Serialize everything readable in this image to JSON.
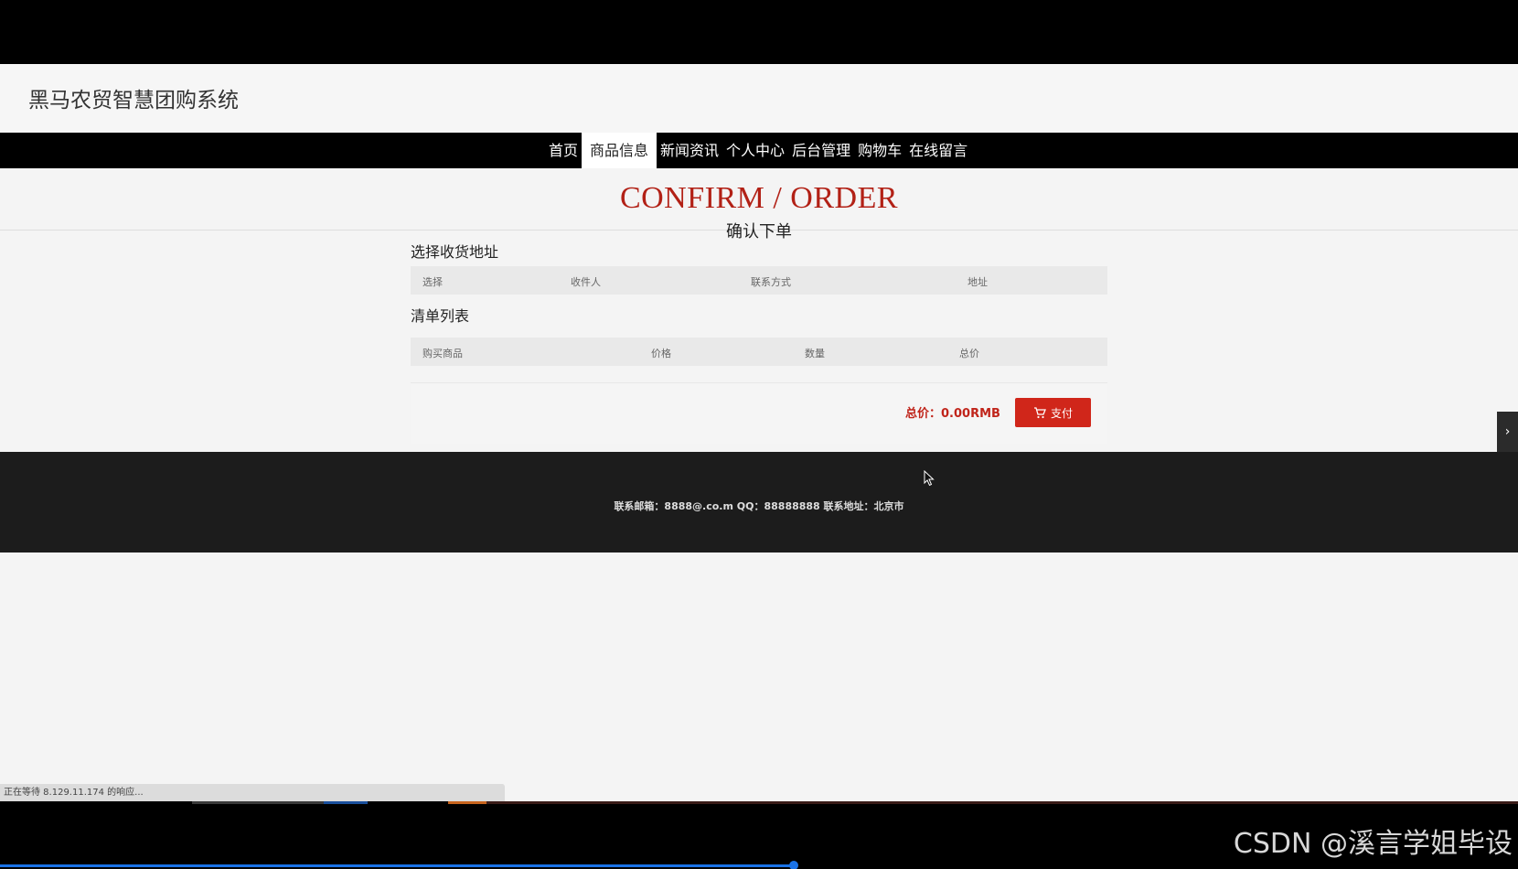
{
  "site": {
    "title": "黑马农贸智慧团购系统"
  },
  "nav": {
    "items": [
      {
        "label": "首页",
        "active": false
      },
      {
        "label": "商品信息",
        "active": true
      },
      {
        "label": "新闻资讯",
        "active": false
      },
      {
        "label": "个人中心",
        "active": false
      },
      {
        "label": "后台管理",
        "active": false
      },
      {
        "label": "购物车",
        "active": false
      },
      {
        "label": "在线留言",
        "active": false
      }
    ]
  },
  "banner": {
    "title": "CONFIRM / ORDER",
    "subtitle": "确认下单"
  },
  "address_section": {
    "title": "选择收货地址",
    "columns": [
      "选择",
      "收件人",
      "联系方式",
      "地址"
    ]
  },
  "list_section": {
    "title": "清单列表",
    "columns": [
      "购买商品",
      "价格",
      "数量",
      "总价"
    ]
  },
  "summary": {
    "total_label": "总价：0.00RMB",
    "pay_label": "支付"
  },
  "footer": {
    "text": "联系邮箱：8888@.co.m QQ：88888888 联系地址：北京市"
  },
  "browser": {
    "status_text": "正在等待 8.129.11.174 的响应..."
  },
  "watermark": "CSDN @溪言学姐毕设",
  "colors": {
    "accent": "#b22116",
    "nav_bg": "#000000",
    "footer_bg": "#1c1c1c",
    "pay_button": "#d0261a"
  }
}
